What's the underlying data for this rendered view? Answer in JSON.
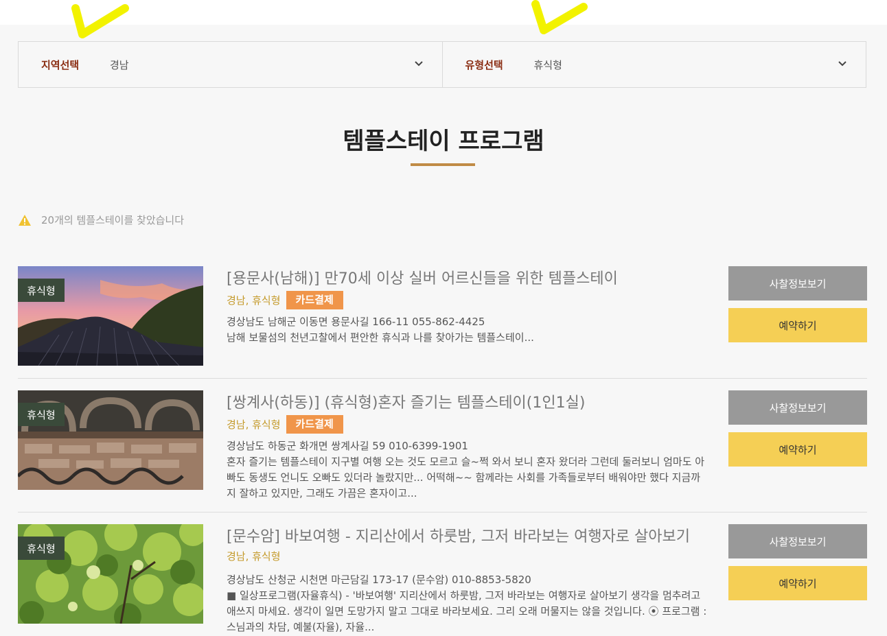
{
  "filters": {
    "region": {
      "label": "지역선택",
      "value": "경남"
    },
    "type": {
      "label": "유형선택",
      "value": "휴식형"
    }
  },
  "page_title": "템플스테이 프로그램",
  "notice": "20개의 템플스테이를 찾았습니다",
  "programs": [
    {
      "badge": "휴식형",
      "title": "[용문사(남해)] 만70세 이상 실버 어르신들을 위한 템플스테이",
      "region_type": "경남, 휴식형",
      "card_label": "카드결제",
      "address": "경상남도 남해군 이동면 용문사길 166-11 055-862-4425",
      "description": "남해 보물섬의 천년고찰에서 편안한 휴식과 나를 찾아가는 템플스테이...",
      "info_button": "사찰정보보기",
      "book_button": "예약하기"
    },
    {
      "badge": "휴식형",
      "title": "[쌍계사(하동)] (휴식형)혼자 즐기는 템플스테이(1인1실)",
      "region_type": "경남, 휴식형",
      "card_label": "카드결제",
      "address": "경상남도 하동군 화개면 쌍계사길 59 010-6399-1901",
      "description": "혼자 즐기는 템플스테이 지구별 여행 오는 것도 모르고 슬~쩍 와서 보니 혼자 왔더라 그런데 둘러보니 엄마도 아빠도 동생도 언니도 오빠도 있더라 놀랐지만... 어떡해~~ 함께라는 사회를 가족들로부터 배워야만 했다 지금까지 잘하고 있지만, 그래도 가끔은 혼자이고...",
      "info_button": "사찰정보보기",
      "book_button": "예약하기"
    },
    {
      "badge": "휴식형",
      "title": "[문수암] 바보여행 - 지리산에서 하룻밤, 그저 바라보는 여행자로 살아보기",
      "region_type": "경남, 휴식형",
      "address": "경상남도 산청군 시천면 마근담길 173-17 (문수암) 010-8853-5820",
      "description": "■ 일상프로그램(자율휴식) - '바보여행' 지리산에서 하룻밤, 그저 바라보는 여행자로 살아보기 생각을 멈추려고 애쓰지 마세요. 생각이 일면 도망가지 말고 그대로 바라보세요. 그리 오래 머물지는 않을 것입니다. ⦿ 프로그램 : 스님과의 차담, 예불(자율), 자율...",
      "info_button": "사찰정보보기",
      "book_button": "예약하기"
    }
  ],
  "colors": {
    "filter_label": "#8a2d12",
    "accent_line": "#c08b46",
    "badge_bg": "#3a4a3a",
    "card_bg": "#f0954a",
    "region_text": "#c49a2a",
    "info_button_bg": "#999999",
    "book_button_bg": "#f5cf55"
  },
  "icons": [
    "checkmark-annotation-icon",
    "chevron-down-icon",
    "warning-icon"
  ]
}
